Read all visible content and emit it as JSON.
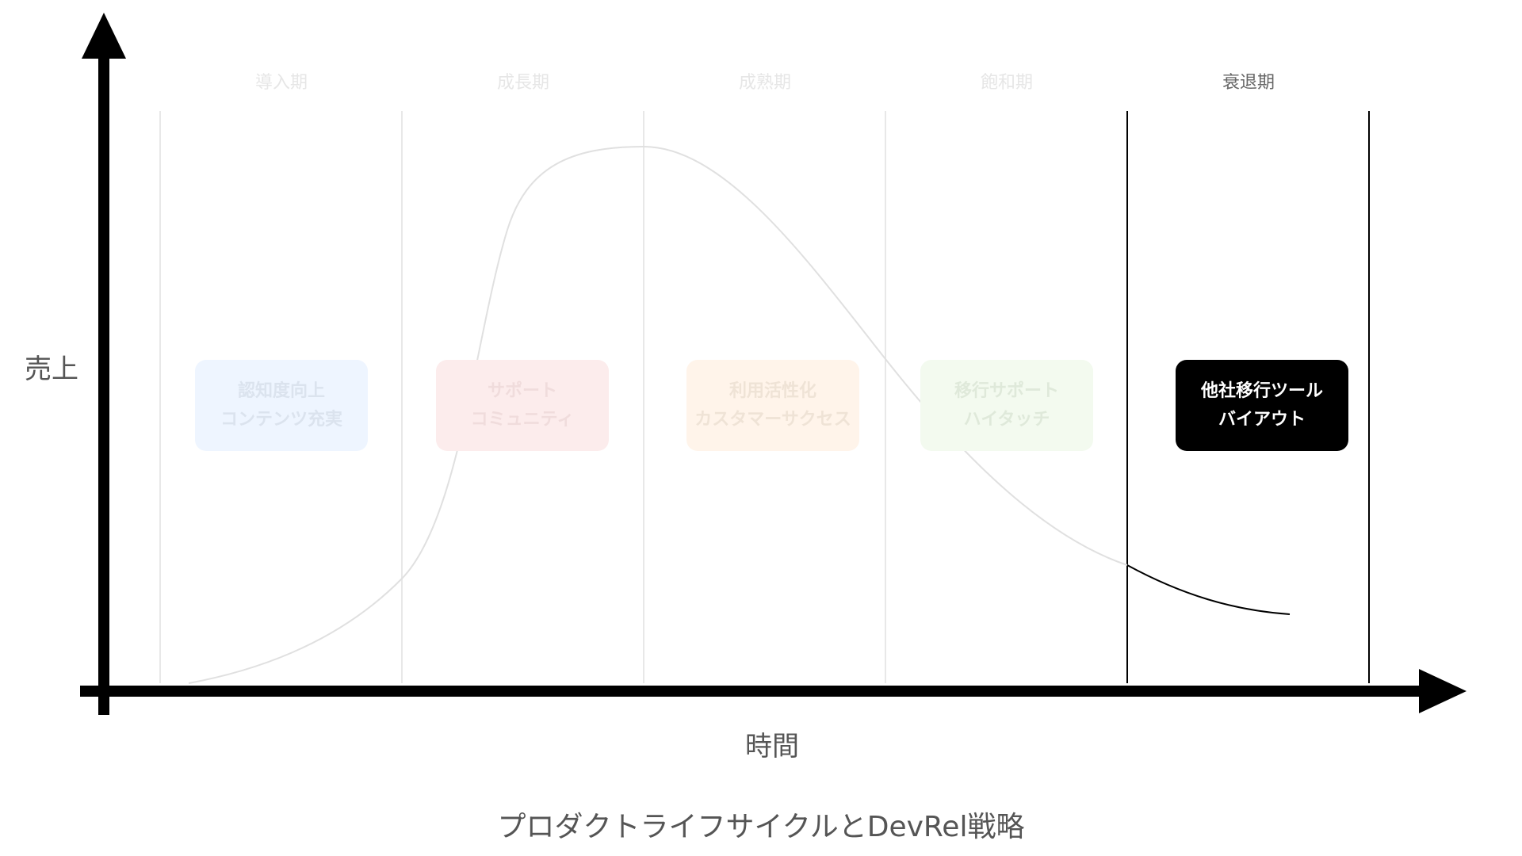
{
  "diagram": {
    "title": "プロダクトライフサイクルとDevRel戦略",
    "y_axis_label": "売上",
    "x_axis_label": "時間",
    "active_phase_index": 4,
    "phases": [
      {
        "name": "導入期",
        "strategy": [
          "認知度向上",
          "コンテンツ充実"
        ],
        "fill": "#eef5ff",
        "text_color": "#dbe3ee",
        "label_color": "#e6e6e6"
      },
      {
        "name": "成長期",
        "strategy": [
          "サポート",
          "コミュニティ"
        ],
        "fill": "#fcecec",
        "text_color": "#f0dcdc",
        "label_color": "#e6e6e6"
      },
      {
        "name": "成熟期",
        "strategy": [
          "利用活性化",
          "カスタマーサクセス"
        ],
        "fill": "#fff4ea",
        "text_color": "#efe3d6",
        "label_color": "#e6e6e6"
      },
      {
        "name": "飽和期",
        "strategy": [
          "移行サポート",
          "ハイタッチ"
        ],
        "fill": "#f3faef",
        "text_color": "#dfe9da",
        "label_color": "#e6e6e6"
      },
      {
        "name": "衰退期",
        "strategy": [
          "他社移行ツール",
          "バイアウト"
        ],
        "fill": "#000000",
        "text_color": "#ffffff",
        "label_color": "#666666"
      }
    ],
    "colors": {
      "axis": "#000000",
      "inactive_divider": "#e8e8e8",
      "inactive_curve": "#e0e0e0",
      "active": "#000000"
    }
  }
}
